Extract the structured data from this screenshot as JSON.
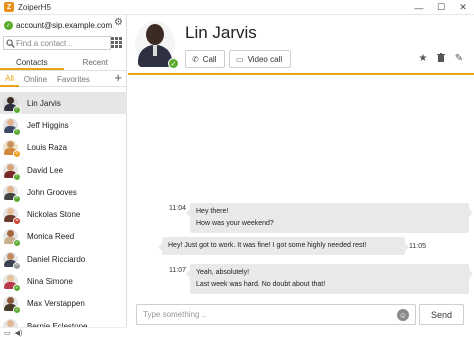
{
  "window": {
    "title": "ZoiperH5",
    "minimize_glyph": "—",
    "maximize_glyph": "☐",
    "close_glyph": "✕"
  },
  "account": {
    "address": "account@sip.example.com",
    "status": "available",
    "status_color": "#5aaa2e"
  },
  "search": {
    "placeholder": "Find a contact ..",
    "value": ""
  },
  "main_tabs": [
    {
      "label": "Contacts",
      "active": true
    },
    {
      "label": "Recent",
      "active": false
    }
  ],
  "filter_tabs": [
    {
      "label": "All",
      "active": true
    },
    {
      "label": "Online",
      "active": false
    },
    {
      "label": "Favorites",
      "active": false
    }
  ],
  "add_contact_glyph": "+",
  "contacts": [
    {
      "name": "Lin Jarvis",
      "presence": "available",
      "selected": true
    },
    {
      "name": "Jeff Higgins",
      "presence": "available"
    },
    {
      "name": "Louis Raza",
      "presence": "away"
    },
    {
      "name": "David Lee",
      "presence": "available"
    },
    {
      "name": "John Grooves",
      "presence": "available"
    },
    {
      "name": "Nickolas Stone",
      "presence": "busy"
    },
    {
      "name": "Monica Reed",
      "presence": "available"
    },
    {
      "name": "Daniel Ricciardo",
      "presence": "offline"
    },
    {
      "name": "Nina Simone",
      "presence": "available"
    },
    {
      "name": "Max Verstappen",
      "presence": "available"
    },
    {
      "name": "Bernie Eclestone",
      "presence": "available"
    }
  ],
  "conversation": {
    "contact_name": "Lin Jarvis",
    "presence": "available",
    "call_label": "Call",
    "video_call_label": "Video call",
    "messages": [
      {
        "direction": "in",
        "time": "11:04",
        "lines": [
          "Hey there!",
          "How was your weekend?"
        ]
      },
      {
        "direction": "out",
        "time": "11:05",
        "lines": [
          "Hey! Just got to work. It was fine! I got some highly needed rest!"
        ]
      },
      {
        "direction": "in",
        "time": "11:07",
        "lines": [
          "Yeah, absolutely!",
          "Last week was hard. No doubt about that!"
        ]
      }
    ]
  },
  "composer": {
    "placeholder": "Type something ..",
    "value": "",
    "send_label": "Send"
  },
  "colors": {
    "accent": "#e8a317",
    "available": "#5aaa2e",
    "away": "#f0a020",
    "busy": "#d0392b",
    "offline": "#9e9e9e",
    "bubble": "#e9e9e9"
  }
}
